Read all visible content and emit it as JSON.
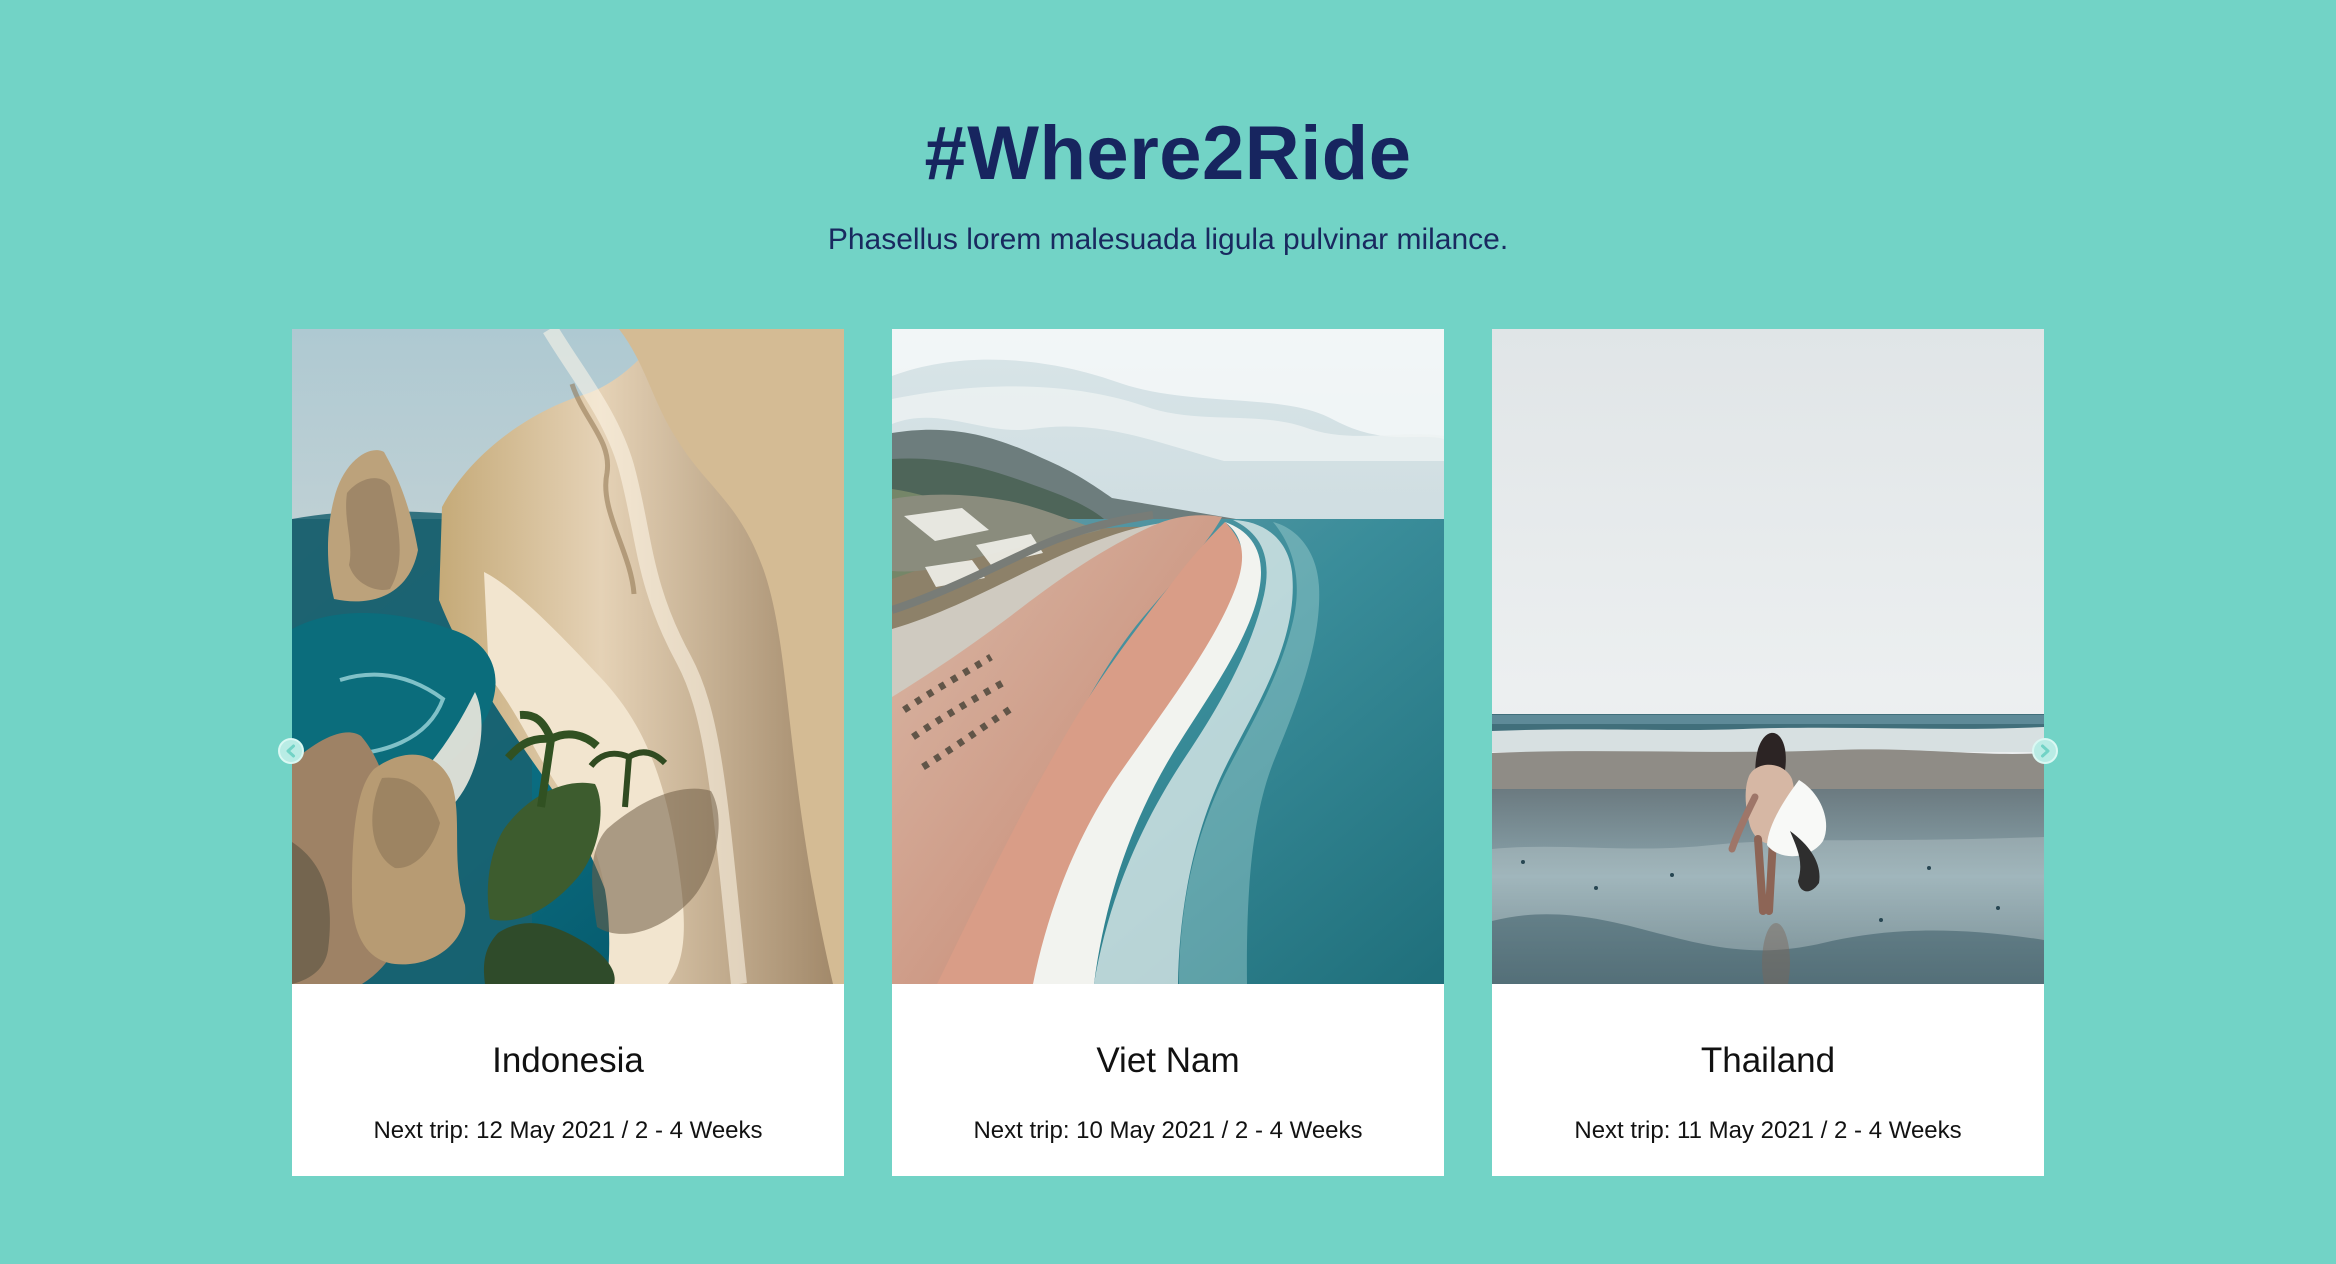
{
  "header": {
    "title": "#Where2Ride",
    "subtitle": "Phasellus lorem malesuada ligula pulvinar milance."
  },
  "slider": {
    "cards": [
      {
        "name": "Indonesia",
        "trip": "Next trip: 12 May 2021 / 2 - 4 Weeks"
      },
      {
        "name": "Viet Nam",
        "trip": "Next trip: 10 May 2021 / 2 - 4 Weeks"
      },
      {
        "name": "Thailand",
        "trip": "Next trip: 11 May 2021 / 2 - 4 Weeks"
      }
    ]
  },
  "icons": {
    "previous": "chevron-left-icon",
    "next": "chevron-right-icon"
  },
  "colors": {
    "background": "#72d3c6",
    "title": "#17255f",
    "card": "#ffffff"
  }
}
